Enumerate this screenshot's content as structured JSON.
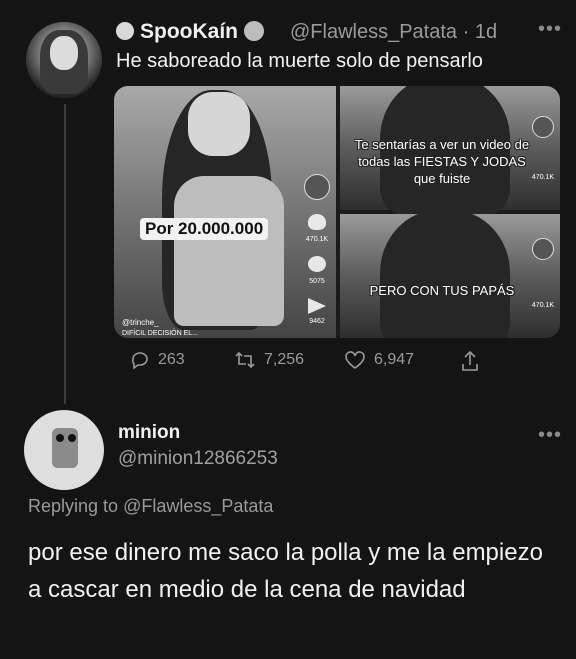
{
  "tweet": {
    "display_name": "SpooKaín",
    "handle": "@Flawless_Patata",
    "time": "· 1d",
    "text": "He saboreado la muerte solo de pensarlo",
    "media": {
      "tile1": {
        "caption": "Por 20.000.000",
        "username": "@trinche_",
        "subtitle": "DIFÍCIL DECISIÓN EL...",
        "likes": "470.1K",
        "comments": "5075",
        "shares": "9462"
      },
      "tile2": {
        "caption": "Te sentarías a ver un video de todas las FIESTAS Y JODAS que fuiste",
        "likes": "470.1K"
      },
      "tile3": {
        "caption": "PERO CON TUS PAPÁS",
        "likes": "470.1K"
      }
    },
    "stats": {
      "replies": "263",
      "retweets": "7,256",
      "likes": "6,947"
    }
  },
  "reply": {
    "display_name": "minion",
    "handle": "@minion12866253",
    "replying_prefix": "Replying to ",
    "replying_to": "@Flawless_Patata",
    "text": "por ese dinero me saco la polla y me la empiezo a cascar en medio de la cena de navidad"
  },
  "icons": {
    "more": "more-dots-icon",
    "reply": "reply-icon",
    "retweet": "retweet-icon",
    "like": "heart-icon",
    "share": "share-icon"
  },
  "colors": {
    "background": "#141414",
    "text": "#e9e9e9",
    "muted": "#9a9a9a"
  }
}
